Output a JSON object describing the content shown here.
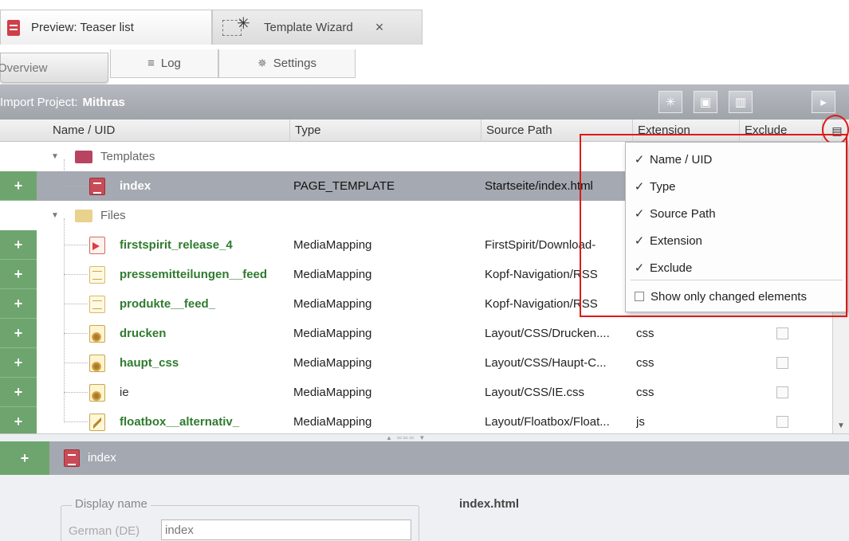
{
  "editor_tabs": [
    {
      "label": "Preview: Teaser list",
      "icon": "document-icon"
    },
    {
      "label": "Template Wizard",
      "icon": "magic-wand-icon",
      "close": "×"
    }
  ],
  "sub_tabs": {
    "overview": "Overview",
    "log": "Log",
    "settings": "Settings",
    "log_icon": "≡",
    "settings_icon": "✵"
  },
  "project": {
    "label": "Import Project:",
    "name": "Mithras"
  },
  "toolbar": {
    "wand_icon": "✳",
    "save_icon": "▣",
    "trash_icon": "▥",
    "play_icon": "▸"
  },
  "columns": {
    "name": "Name / UID",
    "type": "Type",
    "source": "Source Path",
    "extension": "Extension",
    "exclude": "Exclude",
    "menu_icon": "▤"
  },
  "tree": {
    "add_symbol": "+",
    "expand_symbol": "▼",
    "folders": {
      "templates": "Templates",
      "files": "Files"
    },
    "template_rows": [
      {
        "name": "index",
        "type": "PAGE_TEMPLATE",
        "source": "Startseite/index.html",
        "extension": ""
      }
    ],
    "file_rows": [
      {
        "name": "firstspirit_release_4",
        "type": "MediaMapping",
        "source": "FirstSpirit/Download-",
        "extension": ""
      },
      {
        "name": "pressemitteilungen__feed",
        "type": "MediaMapping",
        "source": "Kopf-Navigation/RSS",
        "extension": ""
      },
      {
        "name": "produkte__feed_",
        "type": "MediaMapping",
        "source": "Kopf-Navigation/RSS",
        "extension": ""
      },
      {
        "name": "drucken",
        "type": "MediaMapping",
        "source": "Layout/CSS/Drucken....",
        "extension": "css"
      },
      {
        "name": "haupt_css",
        "type": "MediaMapping",
        "source": "Layout/CSS/Haupt-C...",
        "extension": "css"
      },
      {
        "name": "ie",
        "type": "MediaMapping",
        "source": "Layout/CSS/IE.css",
        "extension": "css"
      },
      {
        "name": "floatbox__alternativ_",
        "type": "MediaMapping",
        "source": "Layout/Floatbox/Float...",
        "extension": "js"
      }
    ]
  },
  "context_menu": {
    "check_symbol": "✓",
    "items": [
      "Name / UID",
      "Type",
      "Source Path",
      "Extension",
      "Exclude"
    ],
    "show_changed": "Show only changed elements"
  },
  "details": {
    "title": "index",
    "add_symbol": "+",
    "fieldset_legend": "Display name",
    "language_label": "German (DE)",
    "display_name_value": "index",
    "filename": "index.html"
  },
  "colors": {
    "added_green": "#6ea56e",
    "name_green": "#2f7b2f",
    "highlight_red": "#e01818",
    "header_grey": "#a4a8b0"
  }
}
